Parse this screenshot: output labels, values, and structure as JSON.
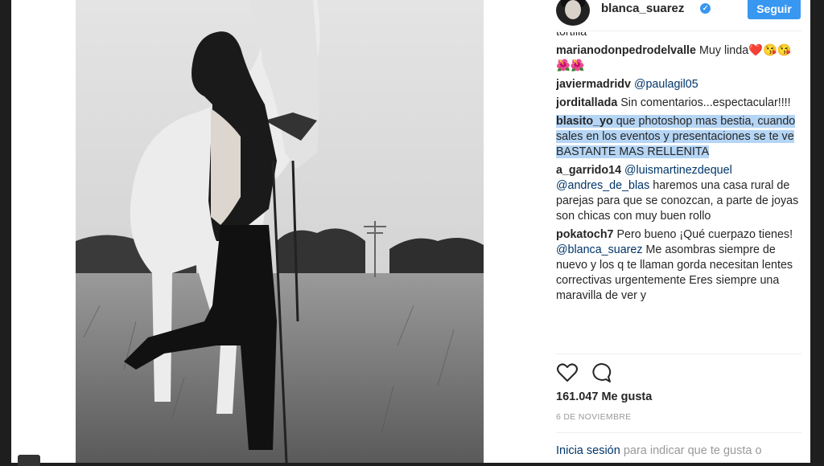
{
  "post": {
    "image_alt": "",
    "username": "blanca_suarez",
    "follow_label": "Seguir",
    "likes": "161.047 Me gusta",
    "date": "6 DE NOVIEMBRE",
    "login_link": "Inicia sesión",
    "login_text": " para indicar que te gusta o"
  },
  "comments": [
    {
      "user": "",
      "text": "tortilla"
    },
    {
      "user": "marianodonpedrodelvalle",
      "text": " Muy linda❤️😘😘 🌺🌺"
    },
    {
      "user": "javiermadridv",
      "mention": "@paulagil05",
      "text": ""
    },
    {
      "user": "jorditallada",
      "text": " Sin comentarios...espectacular!!!!"
    },
    {
      "user": "blasito_yo",
      "text": " que photoshop mas bestia, cuando sales en los eventos y presentaciones se te ve BASTANTE MAS RELLENITA"
    },
    {
      "user": "a_garrido14",
      "mention": "@luismartinezdequel",
      "mention2": "@andres_de_blas",
      "text": " haremos una casa rural de parejas para que se conozcan, a parte de joyas son chicas con muy buen rollo"
    },
    {
      "user": "pokatoch7",
      "text": " Pero bueno ¡Qué cuerpazo tienes! ",
      "mention": "@blanca_suarez",
      "text2": " Me asombras siempre de nuevo y los q te llaman gorda necesitan lentes correctivas urgentemente Eres siempre una maravilla de ver y"
    }
  ],
  "icons": {
    "verified": "verified-badge-icon",
    "like": "heart-icon",
    "comment": "comment-bubble-icon"
  },
  "colors": {
    "accent": "#3897f0",
    "link": "#003569",
    "highlight": "#b5d5f5"
  }
}
